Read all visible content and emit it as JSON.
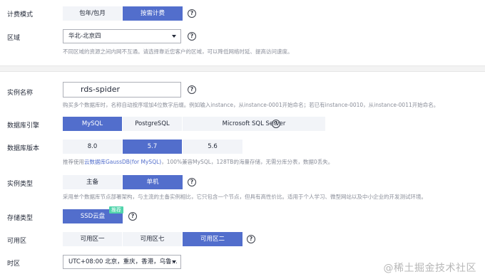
{
  "billing": {
    "label": "计费模式",
    "options": [
      "包年/包月",
      "按需计费"
    ],
    "selected": "按需计费",
    "help": "?"
  },
  "region": {
    "label": "区域",
    "value": "华北-北京四",
    "hint": "不同区域的资源之间内网不互通。请选择靠近您客户的区域，可以降低网络时延、提高访问速度。",
    "help": "?"
  },
  "instance_name": {
    "label": "实例名称",
    "value": "rds-spider",
    "hint": "购买多个数据库时，名称自动按序增加4位数字后缀。例如输入instance，从instance-0001开始命名；若已有instance-0010，从instance-0011开始命名。",
    "help": "?"
  },
  "db_engine": {
    "label": "数据库引擎",
    "options": [
      "MySQL",
      "PostgreSQL",
      "Microsoft SQL Server"
    ],
    "selected": "MySQL",
    "help": "?"
  },
  "db_version": {
    "label": "数据库版本",
    "options": [
      "8.0",
      "5.7",
      "5.6"
    ],
    "selected": "5.7",
    "hint_prefix": "推荐使用",
    "hint_link": "云数据库GaussDB(for MySQL)",
    "hint_suffix": "，100%兼容MySQL，128TB的海量存储，无需分库分表，数据0丢失。"
  },
  "instance_type": {
    "label": "实例类型",
    "options": [
      "主备",
      "单机"
    ],
    "selected": "单机",
    "hint": "采用单个数据库节点部署架构，与主流的主备实例相比，它只包含一个节点，但具有高性价比。适用于个人学习、微型网站以及中小企业的开发测试环境。",
    "help": "?"
  },
  "storage": {
    "label": "存储类型",
    "options": [
      "SSD云盘"
    ],
    "selected": "SSD云盘",
    "badge": "推荐",
    "help": "?"
  },
  "az": {
    "label": "可用区",
    "options": [
      "可用区一",
      "可用区七",
      "可用区二"
    ],
    "selected": "可用区二",
    "help": "?"
  },
  "timezone": {
    "label": "时区",
    "value": "UTC+08:00 北京，重庆，香港，乌鲁..."
  },
  "watermark": "@稀土掘金技术社区",
  "colors": {
    "accent": "#526ecc",
    "option_bg": "#f2f4f8",
    "hint": "#8a8e99",
    "badge": "#50d4ab"
  }
}
